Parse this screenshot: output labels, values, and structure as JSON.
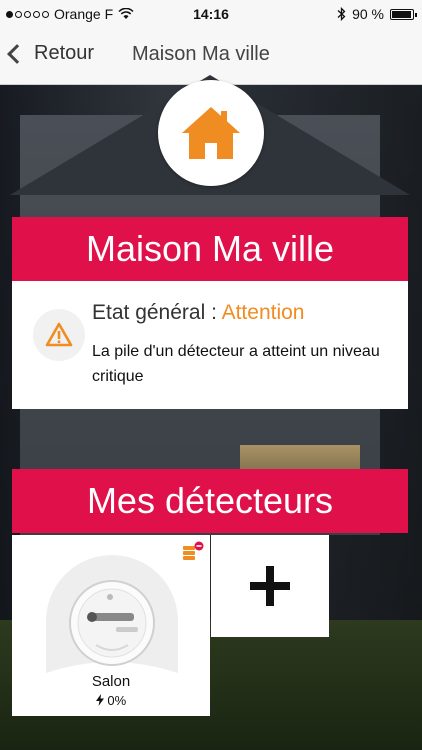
{
  "status_bar": {
    "carrier": "Orange F",
    "time": "14:16",
    "battery": "90 %",
    "battery_level": 0.9,
    "signal_bars": 1
  },
  "nav": {
    "back_label": "Retour",
    "title": "Maison Ma ville"
  },
  "home": {
    "title": "Maison Ma ville",
    "icon": "house-icon",
    "accent_color": "#f08d22"
  },
  "status": {
    "label": "Etat général : ",
    "value": "Attention",
    "message": "La pile d'un détecteur a atteint un niveau critique",
    "icon": "warning-icon"
  },
  "detectors": {
    "title": "Mes détecteurs",
    "items": [
      {
        "name": "Salon",
        "battery": "0%",
        "icon": "smoke-detector-icon",
        "alert_icon": "battery-low-icon"
      }
    ],
    "add_icon": "plus-icon"
  },
  "colors": {
    "header_red": "#e0104a",
    "warning_orange": "#f08d22"
  }
}
